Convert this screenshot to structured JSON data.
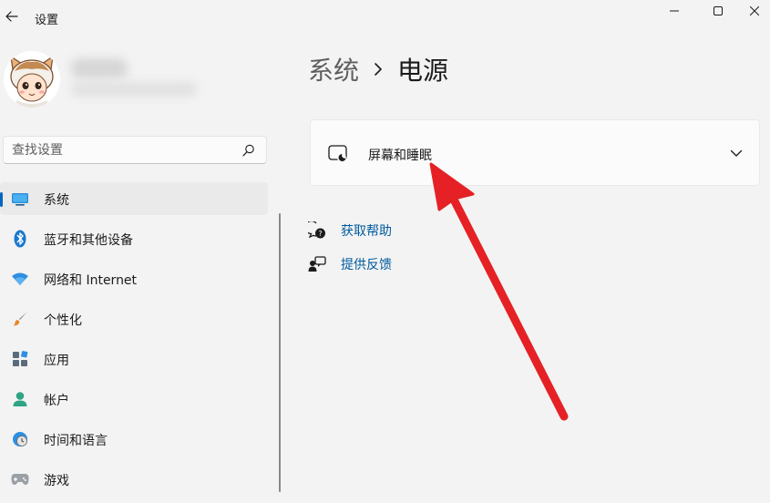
{
  "window": {
    "title": "设置"
  },
  "search": {
    "placeholder": "查找设置"
  },
  "sidebar": {
    "items": [
      {
        "label": "系统",
        "icon": "display-icon",
        "selected": true
      },
      {
        "label": "蓝牙和其他设备",
        "icon": "bluetooth-icon",
        "selected": false
      },
      {
        "label": "网络和 Internet",
        "icon": "wifi-icon",
        "selected": false
      },
      {
        "label": "个性化",
        "icon": "brush-icon",
        "selected": false
      },
      {
        "label": "应用",
        "icon": "apps-icon",
        "selected": false
      },
      {
        "label": "帐户",
        "icon": "person-icon",
        "selected": false
      },
      {
        "label": "时间和语言",
        "icon": "globe-clock-icon",
        "selected": false
      },
      {
        "label": "游戏",
        "icon": "gamepad-icon",
        "selected": false
      }
    ]
  },
  "breadcrumb": {
    "parent": "系统",
    "current": "电源"
  },
  "settings": {
    "screen_sleep_label": "屏幕和睡眠"
  },
  "help": {
    "get_help": "获取帮助",
    "feedback": "提供反馈"
  },
  "colors": {
    "accent": "#0067c0",
    "link": "#005a9e",
    "annotation_arrow": "#e52125"
  }
}
